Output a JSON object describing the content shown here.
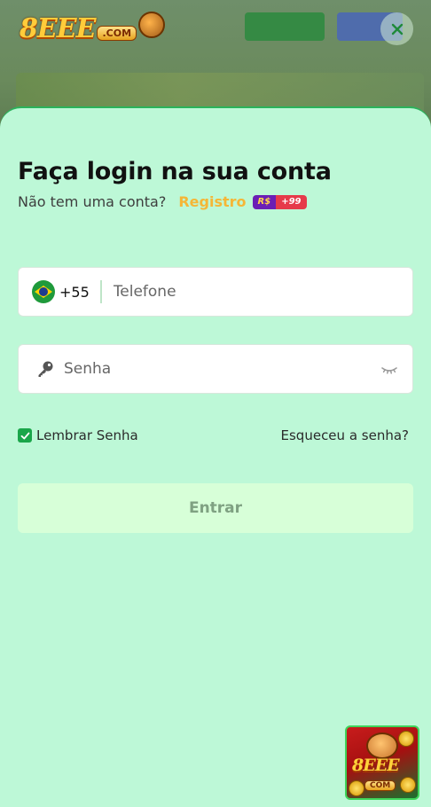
{
  "header": {
    "logo_number": "8EEE",
    "logo_domain": ".COM"
  },
  "login": {
    "title": "Faça login na sua conta",
    "no_account_text": "Não tem uma conta?",
    "register_label": "Registro",
    "bonus_currency": "R$",
    "bonus_amount": "+99"
  },
  "phone": {
    "country_code": "+55",
    "placeholder": "Telefone"
  },
  "password": {
    "placeholder": "Senha"
  },
  "options": {
    "remember_label": "Lembrar Senha",
    "remember_checked": true,
    "forgot_label": "Esqueceu a senha?"
  },
  "submit": {
    "label": "Entrar"
  },
  "promo": {
    "logo_number": "8EEE",
    "logo_domain": "COM"
  },
  "colors": {
    "sheet_background": "#bdf8d7",
    "accent_yellow": "#f5b636",
    "check_green": "#1aa64a",
    "submit_background": "#d7ffd8"
  }
}
